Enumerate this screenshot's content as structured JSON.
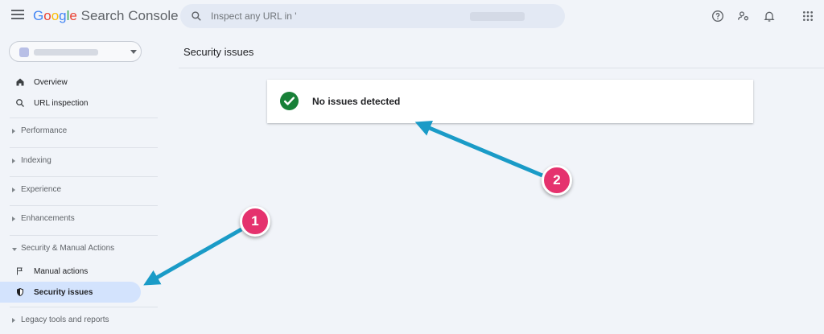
{
  "app": {
    "title_letters": [
      "G",
      "o",
      "o",
      "g",
      "l",
      "e"
    ],
    "product": "Search Console"
  },
  "search": {
    "placeholder": "Inspect any URL in '"
  },
  "header_icons": [
    "help-icon",
    "manage-users-icon",
    "notifications-icon",
    "apps-grid-icon"
  ],
  "sidebar": {
    "items": {
      "overview": "Overview",
      "url_inspection": "URL inspection",
      "performance": "Performance",
      "indexing": "Indexing",
      "experience": "Experience",
      "enhancements": "Enhancements",
      "security_manual": "Security & Manual Actions",
      "manual_actions": "Manual actions",
      "security_issues": "Security issues",
      "legacy": "Legacy tools and reports"
    }
  },
  "main": {
    "title": "Security issues",
    "status": "No issues detected"
  },
  "annotations": {
    "badge_1": "1",
    "badge_2": "2"
  },
  "colors": {
    "accent": "#1a73e8",
    "active_nav": "#d3e3fd",
    "success": "#188038",
    "badge": "#e5326e",
    "arrow": "#1a9bc7"
  }
}
